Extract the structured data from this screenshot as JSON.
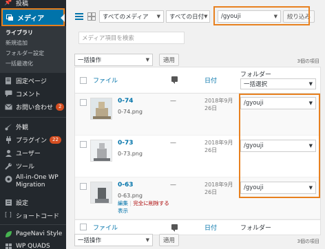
{
  "sidebar": {
    "posts": "投稿",
    "media": "メディア",
    "library": "ライブラリ",
    "add_new": "新規追加",
    "folder_settings": "フォルダー設定",
    "bulk_optimize": "一括最適化",
    "pages": "固定ページ",
    "comments": "コメント",
    "contact": "お問い合わせ",
    "contact_badge": "2",
    "appearance": "外観",
    "plugins": "プラグイン",
    "plugins_badge": "22",
    "users": "ユーザー",
    "tools": "ツール",
    "allinone_1": "All-in-One WP",
    "allinone_2": "Migration",
    "settings": "設定",
    "shortcode": "ショートコード",
    "pagenavi": "PageNavi Style",
    "wpquads": "WP QUADS"
  },
  "filters": {
    "media_type": "すべてのメディア",
    "dates": "すべての日付",
    "folder": "/gyouji",
    "filter_button": "絞り込み"
  },
  "search": {
    "placeholder": "メディア項目を検索"
  },
  "bulk": {
    "action": "一括操作",
    "apply": "適用",
    "count": "3個の項目"
  },
  "table": {
    "headers": {
      "file": "ファイル",
      "date": "日付",
      "folder": "フォルダー",
      "folder_select": "一括選択"
    },
    "rows": [
      {
        "title": "0-74",
        "file": "0-74.png",
        "comment": "—",
        "date1": "2018年9月",
        "date2": "26日",
        "folder": "/gyouji"
      },
      {
        "title": "0-73",
        "file": "0-73.png",
        "comment": "—",
        "date1": "2018年9月",
        "date2": "26日",
        "folder": "/gyouji"
      },
      {
        "title": "0-63",
        "file": "0-63.png",
        "comment": "—",
        "date1": "2018年9月",
        "date2": "26日",
        "folder": "/gyouji",
        "actions": {
          "edit": "編集",
          "delete": "完全に削除する",
          "view": "表示"
        }
      }
    ]
  },
  "colors": {
    "accent": "#0073aa",
    "highlight": "#e8801e",
    "sidebar": "#23282d"
  }
}
